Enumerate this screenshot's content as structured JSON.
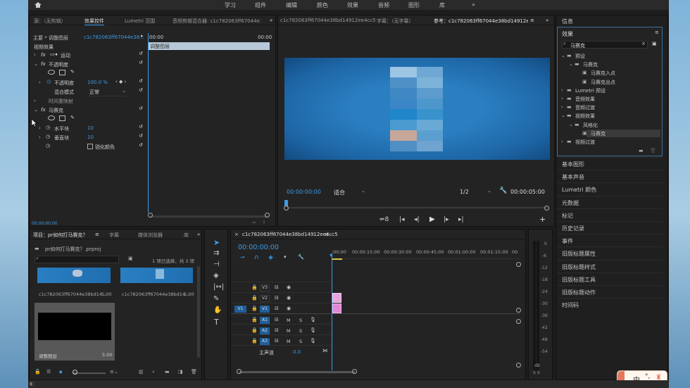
{
  "top": {
    "nav": [
      "学习",
      "组件",
      "编辑",
      "颜色",
      "效果",
      "音频",
      "图形",
      "库"
    ],
    "more": "»"
  },
  "effect_controls": {
    "tabs": [
      "源：（无剪辑）",
      "效果控件",
      "Lumetri 范围",
      "音频剪辑混合器: c1c782063ff67044e38"
    ],
    "tab_more": "»",
    "master": "主要 * 调整图层",
    "clip": "c1c782063ff67044e38...",
    "time_start": "00:00",
    "time_end": "00:00",
    "layer_label": "调整图层",
    "video_effects": "视频效果",
    "motion": "运动",
    "opacity": "不透明度",
    "opacity_prop": "不透明度",
    "opacity_value": "100.0 %",
    "blend_mode": "混合模式",
    "blend_value": "正常",
    "time_remap": "时间重映射",
    "mosaic": "马赛克",
    "h_blocks": "水平块",
    "h_value": "10",
    "v_blocks": "垂直块",
    "v_value": "10",
    "sharpen": "锐化颜色",
    "timecode": "00:00:00:00",
    "fx": "fx"
  },
  "program": {
    "source_tab": "c1c782063ff67044e38bd14912ee4cc5",
    "caption_tab": "字幕：（无字幕）",
    "program_tab": "参考：c1c782063ff67044e38bd14912ee4cc5",
    "timecode": "00:00:00:00",
    "fit": "适合",
    "quality": "1/2",
    "duration": "00:00:05:00"
  },
  "project": {
    "tabs": [
      "项目：pr如何打马赛克？",
      "字幕",
      "媒体浏览器",
      "库"
    ],
    "path": "pr如何打马赛克？.prproj",
    "selection": "1 项已选择，共 3 项",
    "items": [
      {
        "name": "c1c782063ff67044e38bd14...",
        "dur": "5:00"
      },
      {
        "name": "c1c782063ff67044e38bd14...",
        "dur": "5:00"
      },
      {
        "name": "调整图层",
        "dur": "5:00"
      }
    ]
  },
  "timeline": {
    "tab": "c1c782063ff67044e38bd14912ee4cc5",
    "timecode": "00:00:00:00",
    "ruler": [
      ":00:00",
      "00:00:15:00",
      "00:00:30:00",
      "00:00:45:00",
      "00:01:00:00",
      "00:01:15:00",
      "00"
    ],
    "video_tracks": [
      "V3",
      "V2",
      "V1"
    ],
    "audio_tracks": [
      "A1",
      "A2",
      "A3"
    ],
    "source_v": "V1",
    "master": "主声道",
    "master_val": "0.0",
    "m": "M",
    "s": "S"
  },
  "meter": {
    "levels": [
      "0",
      "-6",
      "-12",
      "-18",
      "-24",
      "-30",
      "-36",
      "-42",
      "-48",
      "-54",
      "dB"
    ]
  },
  "effects_panel": {
    "header": "信息",
    "title": "效果",
    "search": "马赛克",
    "tree": [
      {
        "label": "预设",
        "level": 0,
        "type": "folder"
      },
      {
        "label": "马赛克",
        "level": 1,
        "type": "folder"
      },
      {
        "label": "马赛克入点",
        "level": 2,
        "type": "preset"
      },
      {
        "label": "马赛克出点",
        "level": 2,
        "type": "preset"
      },
      {
        "label": "Lumetri 预设",
        "level": 0,
        "type": "folder"
      },
      {
        "label": "音频效果",
        "level": 0,
        "type": "folder"
      },
      {
        "label": "音频过渡",
        "level": 0,
        "type": "folder"
      },
      {
        "label": "视频效果",
        "level": 0,
        "type": "folder"
      },
      {
        "label": "风格化",
        "level": 1,
        "type": "folder"
      },
      {
        "label": "马赛克",
        "level": 2,
        "type": "effect",
        "selected": true
      },
      {
        "label": "视频过渡",
        "level": 0,
        "type": "folder"
      }
    ],
    "collapsed": [
      "基本图形",
      "基本声音",
      "Lumetri 颜色",
      "元数据",
      "标记",
      "历史记录",
      "事件",
      "旧版标题属性",
      "旧版标题样式",
      "旧版标题工具",
      "旧版标题动作",
      "时间码"
    ]
  },
  "ime": {
    "label": "中"
  }
}
